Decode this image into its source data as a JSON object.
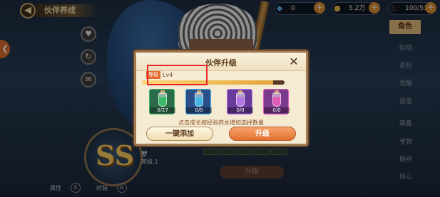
{
  "header": {
    "title": "伙伴养成",
    "back_icon": "back-arrow-icon"
  },
  "resources": [
    {
      "name": "diamond",
      "icon": "diamond-icon",
      "value": "0",
      "color": "#5aa7e6"
    },
    {
      "name": "gold",
      "icon": "coin-icon",
      "value": "5.2万",
      "color": "#e6b64a"
    },
    {
      "name": "stamina",
      "icon": "meat-icon",
      "value": "100/53",
      "color": "#d36b3a"
    }
  ],
  "side_tabs": {
    "active": "角色",
    "others": [
      "阶级",
      "进化",
      "觉醒",
      "技能",
      "装备",
      "宝物",
      "羁绊",
      "核心"
    ]
  },
  "character": {
    "grade": "SS",
    "name": "罗",
    "level_text": "等级.1"
  },
  "bottom_bar": {
    "attr_label": "属性",
    "fruit_label": "时装"
  },
  "background_upgrade_label": "升级",
  "dialog": {
    "title": "伙伴升级",
    "close_icon": "close-icon",
    "level_tag": "等级",
    "level_value": "Lv4",
    "exp_fraction": 0.92,
    "potions": [
      {
        "icon": "green-potion-icon",
        "count": "0/27",
        "color": "#3dbb6a",
        "bg": "#2b6c4a"
      },
      {
        "icon": "blue-potion-icon",
        "count": "0/0",
        "color": "#43b6e6",
        "bg": "#2b4f8a"
      },
      {
        "icon": "purple-potion-icon",
        "count": "0/0",
        "color": "#b677e6",
        "bg": "#6a3a9a"
      },
      {
        "icon": "pink-potion-icon",
        "count": "0/0",
        "color": "#e05ab6",
        "bg": "#7a3a8e"
      }
    ],
    "hint": "点击成长按经验药水增加选择数量",
    "auto_add_label": "一键添加",
    "upgrade_label": "升级"
  }
}
